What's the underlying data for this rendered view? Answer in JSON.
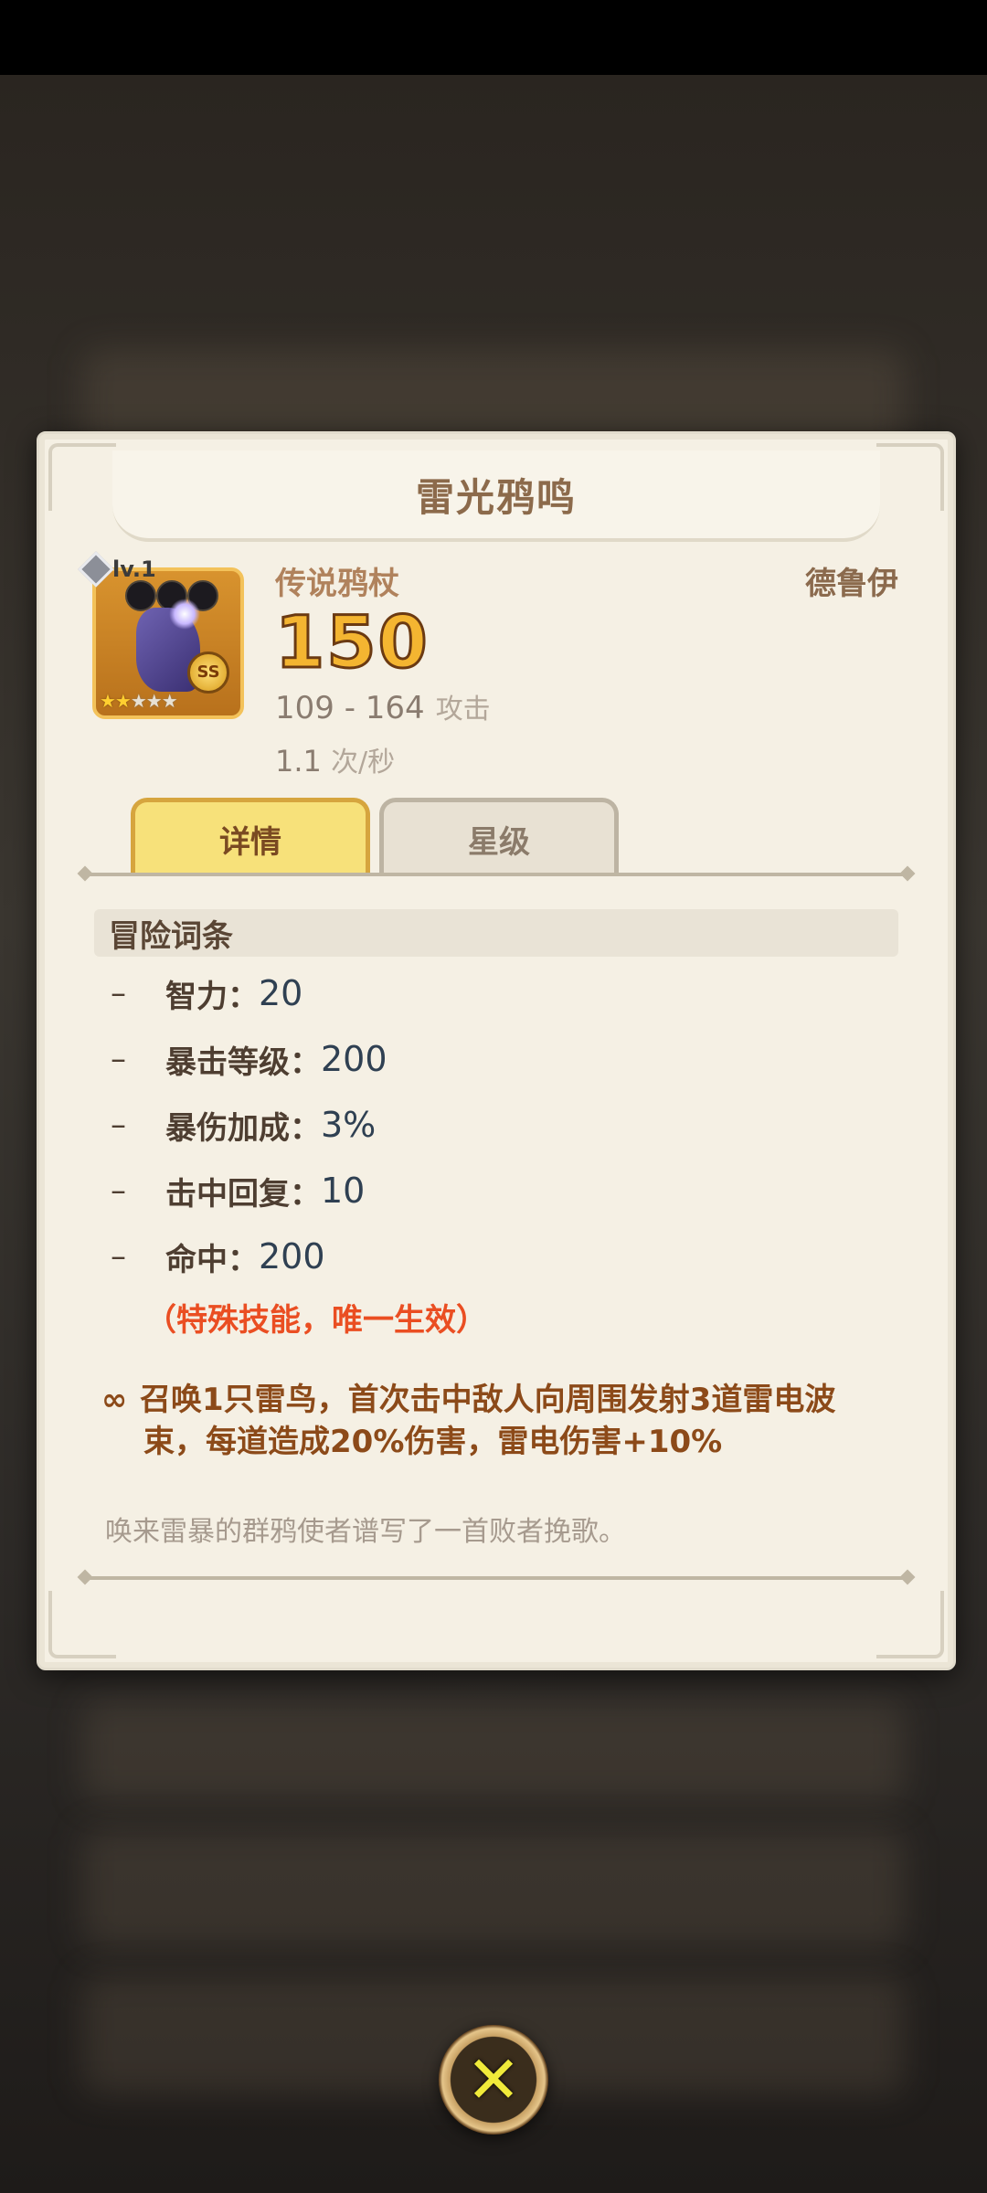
{
  "title": "雷光鸦鸣",
  "item": {
    "level": "lv.1",
    "weapon_type": "传说鸦杖",
    "class_name": "德鲁伊",
    "power": "150",
    "attack_range": "109 - 164",
    "attack_label": "攻击",
    "speed_value": "1.1",
    "speed_unit": "次/秒",
    "badge": "SS",
    "stars_filled": 2,
    "stars_total": 5
  },
  "tabs": [
    {
      "label": "详情",
      "active": true
    },
    {
      "label": "星级",
      "active": false
    }
  ],
  "section_title": "冒险词条",
  "attributes": [
    {
      "name": "智力：",
      "value": "20"
    },
    {
      "name": "暴击等级：",
      "value": "200"
    },
    {
      "name": "暴伤加成：",
      "value": "3%"
    },
    {
      "name": "击中回复：",
      "value": "10"
    },
    {
      "name": "命中：",
      "value": "200"
    }
  ],
  "dash": "–",
  "special_note": "（特殊技能，唯一生效）",
  "skill": {
    "icon": "link-icon",
    "line1": "召唤1只雷鸟，首次击中敌人向周围发射3道雷电波",
    "line2": "束，每道造成20%伤害，雷电伤害+10%"
  },
  "flavor_text": "唤来雷暴的群鸦使者谱写了一首败者挽歌。",
  "close_icon": "close-icon",
  "colors": {
    "accent": "#f7e17a",
    "power": "#f4b531",
    "special": "#ea4e22",
    "skill": "#8c4a19"
  }
}
